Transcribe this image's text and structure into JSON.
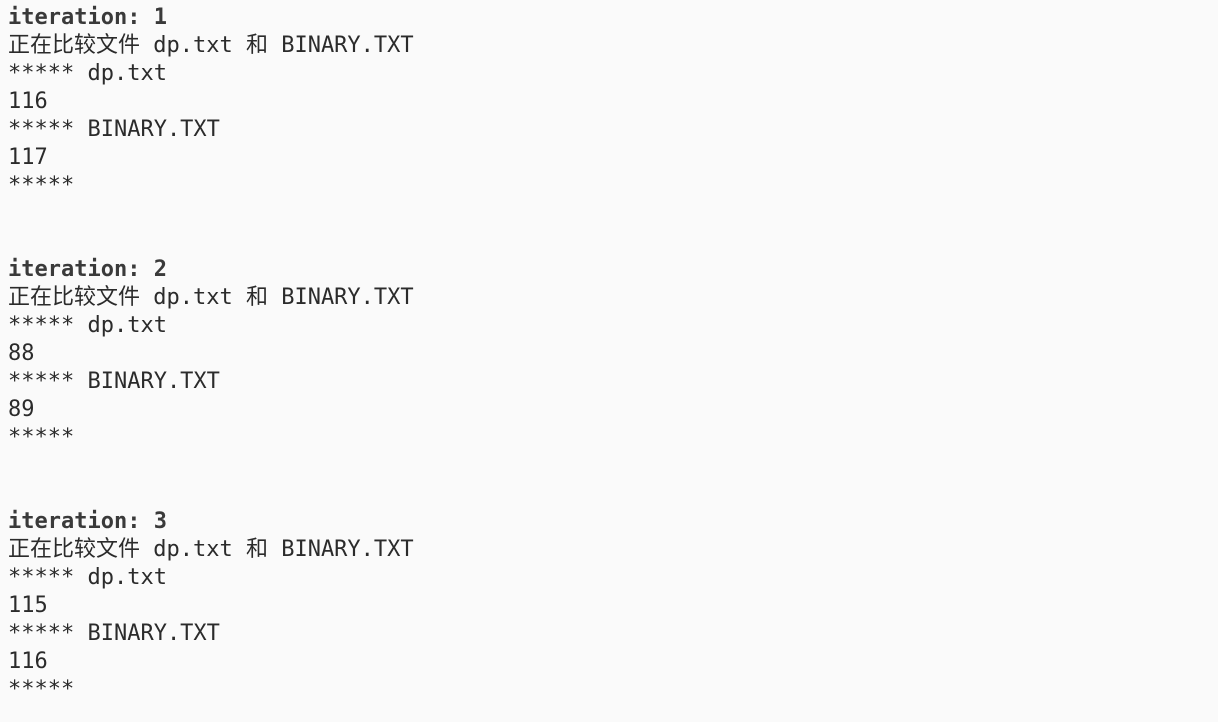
{
  "console": {
    "iterations": [
      {
        "header": "iteration: 1",
        "compare": "正在比较文件 dp.txt 和 BINARY.TXT",
        "file1_marker": "***** dp.txt",
        "file1_value": "116",
        "file2_marker": "***** BINARY.TXT",
        "file2_value": "117",
        "end_marker": "*****"
      },
      {
        "header": "iteration: 2",
        "compare": "正在比较文件 dp.txt 和 BINARY.TXT",
        "file1_marker": "***** dp.txt",
        "file1_value": "88",
        "file2_marker": "***** BINARY.TXT",
        "file2_value": "89",
        "end_marker": "*****"
      },
      {
        "header": "iteration: 3",
        "compare": "正在比较文件 dp.txt 和 BINARY.TXT",
        "file1_marker": "***** dp.txt",
        "file1_value": "115",
        "file2_marker": "***** BINARY.TXT",
        "file2_value": "116",
        "end_marker": "*****"
      }
    ]
  }
}
